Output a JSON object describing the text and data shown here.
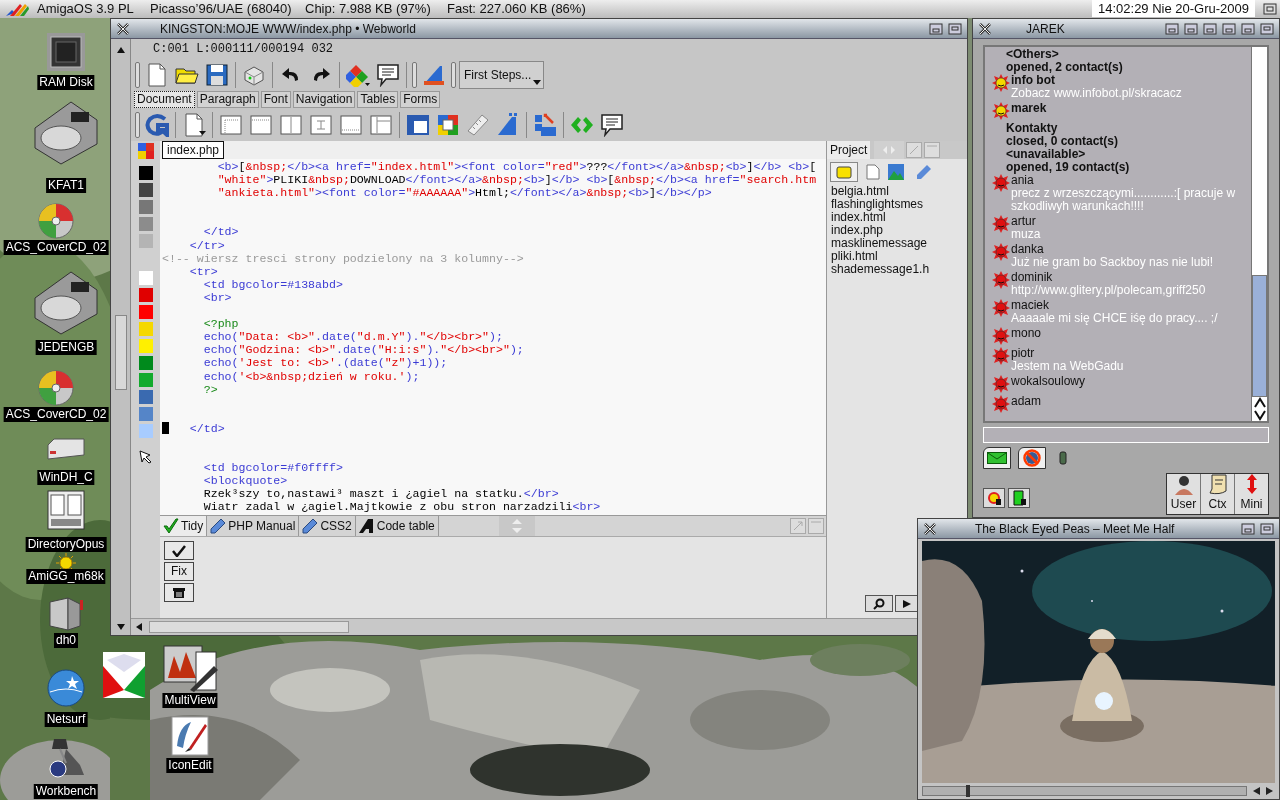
{
  "menubar": {
    "os": "AmigaOS 3.9 PL",
    "gfx": "Picasso’96/UAE (68040)",
    "chip": "Chip: 7.988 KB (97%)",
    "fast": "Fast: 227.060 KB (86%)",
    "clock": "14:02:29 Nie 20-Gru-2009"
  },
  "desktop_icons": [
    {
      "label": "RAM Disk",
      "kind": "chip"
    },
    {
      "label": "KFAT1",
      "kind": "harddisk"
    },
    {
      "label": "ACS_CoverCD_02",
      "kind": "cd"
    },
    {
      "label": "JEDENGB",
      "kind": "harddisk"
    },
    {
      "label": "ACS_CoverCD_02",
      "kind": "cd"
    },
    {
      "label": "WinDH_C",
      "kind": "drive"
    },
    {
      "label": "DirectoryOpus",
      "kind": "filer"
    },
    {
      "label": "AmiGG_m68k",
      "kind": "sun"
    },
    {
      "label": "dh0",
      "kind": "tower"
    },
    {
      "label": "Netsurf",
      "kind": "globe"
    },
    {
      "label": "Workbench",
      "kind": "lamp"
    },
    {
      "label": "MultiView",
      "kind": "viewer"
    },
    {
      "label": "IconEdit",
      "kind": "brush"
    },
    {
      "kind": "diamond"
    }
  ],
  "editor": {
    "title": "KINGSTON:MOJE WWW/index.php • Webworld",
    "status": "C:001 L:000111/000194 032",
    "first_steps": "First Steps...",
    "tabs": [
      {
        "label": "Document",
        "selected": true
      },
      {
        "label": "Paragraph",
        "selected": false
      },
      {
        "label": "Font",
        "selected": false
      },
      {
        "label": "Navigation",
        "selected": false
      },
      {
        "label": "Tables",
        "selected": false
      },
      {
        "label": "Forms",
        "selected": false
      }
    ],
    "palette": [
      {
        "swatches": [
          {
            "color": "#000000"
          },
          {
            "color": "#444444"
          },
          {
            "color": "#777777"
          },
          {
            "color": "#8c8c8c"
          },
          {
            "color": "#b4b4b4"
          }
        ]
      },
      {
        "swatches": [
          {
            "color": "#ffffff"
          },
          {
            "color": "#e00000"
          },
          {
            "color": "#ff0000"
          },
          {
            "color": "#f5d800"
          },
          {
            "color": "#fff000"
          },
          {
            "color": "#008a1c"
          },
          {
            "color": "#12aa2c"
          },
          {
            "color": "#3a6ab0"
          },
          {
            "color": "#5585c8"
          },
          {
            "color": "#a8ccff"
          }
        ]
      }
    ],
    "file_tab": "index.php",
    "lines": [
      {
        "kind": "code",
        "segments": [
          {
            "kind": "tag",
            "text": "        <b>"
          },
          {
            "kind": "text",
            "text": "["
          },
          {
            "kind": "str",
            "text": "&nbsp;"
          },
          {
            "kind": "tag",
            "text": "</b><a href="
          },
          {
            "kind": "str",
            "text": "\"index.html\""
          },
          {
            "kind": "tag",
            "text": "><font color="
          },
          {
            "kind": "str",
            "text": "\"red\""
          },
          {
            "kind": "tag",
            "text": ">"
          },
          {
            "kind": "text",
            "text": "???"
          },
          {
            "kind": "tag",
            "text": "</font></a>"
          },
          {
            "kind": "str",
            "text": "&nbsp;"
          },
          {
            "kind": "tag",
            "text": "<b>"
          },
          {
            "kind": "text",
            "text": "]"
          },
          {
            "kind": "tag",
            "text": "</b> <b>"
          },
          {
            "kind": "text",
            "text": "["
          }
        ]
      },
      {
        "kind": "code",
        "segments": [
          {
            "kind": "str",
            "text": "        \"white\""
          },
          {
            "kind": "tag",
            "text": ">"
          },
          {
            "kind": "text",
            "text": "PLIKI"
          },
          {
            "kind": "str",
            "text": "&nbsp;"
          },
          {
            "kind": "text",
            "text": "DOWNLOAD"
          },
          {
            "kind": "tag",
            "text": "</font></a>"
          },
          {
            "kind": "str",
            "text": "&nbsp;"
          },
          {
            "kind": "tag",
            "text": "<b>"
          },
          {
            "kind": "text",
            "text": "]"
          },
          {
            "kind": "tag",
            "text": "</b> <b>"
          },
          {
            "kind": "text",
            "text": "["
          },
          {
            "kind": "str",
            "text": "&nbsp;"
          },
          {
            "kind": "tag",
            "text": "</b><a href="
          },
          {
            "kind": "str",
            "text": "\"search.htm"
          }
        ]
      },
      {
        "kind": "code",
        "segments": [
          {
            "kind": "str",
            "text": "        \"ankieta.html\""
          },
          {
            "kind": "tag",
            "text": "><font color="
          },
          {
            "kind": "str",
            "text": "\"#AAAAAA\""
          },
          {
            "kind": "tag",
            "text": ">"
          },
          {
            "kind": "text",
            "text": "Html;"
          },
          {
            "kind": "tag",
            "text": "</font></a>"
          },
          {
            "kind": "str",
            "text": "&nbsp;"
          },
          {
            "kind": "tag",
            "text": "<b>"
          },
          {
            "kind": "text",
            "text": "]"
          },
          {
            "kind": "tag",
            "text": "</b></p>"
          }
        ]
      },
      {
        "kind": "blank"
      },
      {
        "kind": "blank"
      },
      {
        "kind": "code",
        "segments": [
          {
            "kind": "tag",
            "text": "      </td>"
          }
        ]
      },
      {
        "kind": "code",
        "segments": [
          {
            "kind": "tag",
            "text": "    </tr>"
          }
        ]
      },
      {
        "kind": "code",
        "segments": [
          {
            "kind": "comment",
            "text": "<!-- wiersz tresci strony podzielony na 3 kolumny-->"
          }
        ]
      },
      {
        "kind": "code",
        "segments": [
          {
            "kind": "tag",
            "text": "    <tr>"
          }
        ]
      },
      {
        "kind": "code",
        "segments": [
          {
            "kind": "tag",
            "text": "      <td bgcolor=#138abd>"
          }
        ]
      },
      {
        "kind": "code",
        "segments": [
          {
            "kind": "tag",
            "text": "      <br>"
          }
        ]
      },
      {
        "kind": "blank"
      },
      {
        "kind": "code",
        "segments": [
          {
            "kind": "php",
            "text": "      <?php"
          }
        ]
      },
      {
        "kind": "code",
        "segments": [
          {
            "kind": "tag",
            "text": "      echo("
          },
          {
            "kind": "str",
            "text": "\"Data: <b>\""
          },
          {
            "kind": "tag",
            "text": ".date("
          },
          {
            "kind": "str",
            "text": "\"d.m.Y\""
          },
          {
            "kind": "tag",
            "text": ")."
          },
          {
            "kind": "str",
            "text": "\"</b><br>\""
          },
          {
            "kind": "tag",
            "text": ");"
          }
        ]
      },
      {
        "kind": "code",
        "segments": [
          {
            "kind": "tag",
            "text": "      echo("
          },
          {
            "kind": "str",
            "text": "\"Godzina: <b>\""
          },
          {
            "kind": "tag",
            "text": ".date("
          },
          {
            "kind": "str",
            "text": "\"H:i:s\""
          },
          {
            "kind": "tag",
            "text": ")."
          },
          {
            "kind": "str",
            "text": "\"</b><br>\""
          },
          {
            "kind": "tag",
            "text": ");"
          }
        ]
      },
      {
        "kind": "code",
        "segments": [
          {
            "kind": "tag",
            "text": "      echo("
          },
          {
            "kind": "str",
            "text": "'Jest to: <b>'"
          },
          {
            "kind": "tag",
            "text": ".(date("
          },
          {
            "kind": "str",
            "text": "\"z\""
          },
          {
            "kind": "tag",
            "text": ")+1));"
          }
        ]
      },
      {
        "kind": "code",
        "segments": [
          {
            "kind": "tag",
            "text": "      echo("
          },
          {
            "kind": "str",
            "text": "'<b>&nbsp;dzień w roku.'"
          },
          {
            "kind": "tag",
            "text": ");"
          }
        ]
      },
      {
        "kind": "code",
        "segments": [
          {
            "kind": "php",
            "text": "      ?>"
          }
        ]
      },
      {
        "kind": "blank"
      },
      {
        "kind": "blank"
      },
      {
        "kind": "code",
        "segments": [
          {
            "kind": "cursor"
          },
          {
            "kind": "tag",
            "text": "   </td>"
          }
        ]
      },
      {
        "kind": "blank"
      },
      {
        "kind": "blank"
      },
      {
        "kind": "code",
        "segments": [
          {
            "kind": "tag",
            "text": "      <td bgcolor=#f0ffff>"
          }
        ]
      },
      {
        "kind": "code",
        "segments": [
          {
            "kind": "tag",
            "text": "      <blockquote>"
          }
        ]
      },
      {
        "kind": "code",
        "segments": [
          {
            "kind": "text",
            "text": "      Rzek³szy to,nastawi³ maszt i ¿agiel na statku."
          },
          {
            "kind": "tag",
            "text": "</br>"
          }
        ]
      },
      {
        "kind": "code",
        "segments": [
          {
            "kind": "text",
            "text": "      Wiatr zadal w ¿agiel.Majtkowie z obu stron narzadzili"
          },
          {
            "kind": "tag",
            "text": "<br>"
          }
        ]
      }
    ],
    "bottom_tabs": [
      {
        "label": "Tidy",
        "kind": "check",
        "selected": true
      },
      {
        "label": "PHP Manual",
        "kind": "pen",
        "selected": false
      },
      {
        "label": "CSS2",
        "kind": "pen",
        "selected": false
      },
      {
        "label": "Code table",
        "kind": "letter",
        "selected": false
      }
    ],
    "fix_label": "Fix",
    "project": {
      "tab": "Project",
      "files": [
        "belgia.html",
        "flashinglightsmes",
        "index.html",
        "index.php",
        "masklinemessage",
        "pliki.html",
        "shademessage1.h"
      ]
    }
  },
  "chat": {
    "title": "JAREK",
    "items": [
      {
        "kind": "header",
        "text": "<Others>"
      },
      {
        "kind": "header",
        "text": "opened, 2 contact(s)"
      },
      {
        "kind": "contact",
        "name": "info bot",
        "available": true,
        "message": "Zobacz www.infobot.pl/skracacz"
      },
      {
        "kind": "contact",
        "name": "marek",
        "available": true
      },
      {
        "kind": "header",
        "text": "Kontakty"
      },
      {
        "kind": "header",
        "text": "closed, 0 contact(s)"
      },
      {
        "kind": "header",
        "text": "<unavailable>"
      },
      {
        "kind": "header",
        "text": "opened, 19 contact(s)"
      },
      {
        "kind": "contact",
        "name": "ania",
        "available": false,
        "message": "precz z wrzeszczącymi............:[ pracuje w szkodliwyh warunkach!!!!"
      },
      {
        "kind": "contact",
        "name": "artur",
        "available": false,
        "message": "muza"
      },
      {
        "kind": "contact",
        "name": "danka",
        "available": false,
        "message": "Już nie gram bo Sackboy nas nie lubi!"
      },
      {
        "kind": "contact",
        "name": "dominik",
        "available": false,
        "message": "http://www.glitery.pl/polecam,griff250"
      },
      {
        "kind": "contact",
        "name": "maciek",
        "available": false,
        "message": "Aaaaale mi się CHCE iśę do pracy.... ;/"
      },
      {
        "kind": "contact",
        "name": "mono",
        "available": false
      },
      {
        "kind": "contact",
        "name": "piotr",
        "available": false,
        "message": "Jestem na WebGadu"
      },
      {
        "kind": "contact",
        "name": "wokalsoulowy",
        "available": false
      },
      {
        "kind": "contact",
        "name": "adam",
        "available": false
      }
    ],
    "buttons": [
      "User",
      "Ctx",
      "Mini"
    ]
  },
  "player": {
    "title": "The Black Eyed Peas – Meet Me Half",
    "seek": {
      "level": 0.14
    }
  }
}
